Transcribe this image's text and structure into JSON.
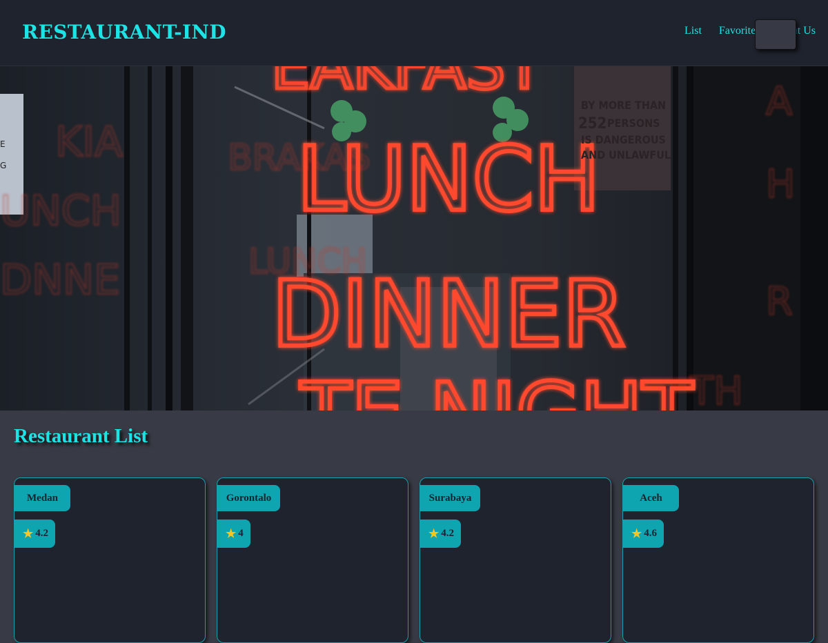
{
  "header": {
    "brand": "RESTAURANT-IND",
    "nav": [
      {
        "label": "List"
      },
      {
        "label": "Favorite"
      },
      {
        "label": "About Us"
      }
    ]
  },
  "hero": {
    "sign_lines": [
      "LUNCH",
      "DINNER"
    ],
    "notice_lines": [
      "BY MORE THAN",
      "252",
      "PERSONS",
      "IS DANGEROUS",
      "AND UNLAWFUL"
    ]
  },
  "main": {
    "title": "Restaurant List",
    "restaurants": [
      {
        "city": "Medan",
        "rating": "4.2"
      },
      {
        "city": "Gorontalo",
        "rating": "4"
      },
      {
        "city": "Surabaya",
        "rating": "4.2"
      },
      {
        "city": "Aceh",
        "rating": "4.6"
      }
    ]
  },
  "colors": {
    "accent": "#1ee3e6",
    "header_bg": "#1f232d",
    "page_bg": "#383b45",
    "badge_bg": "#0ea4b0",
    "neon": "#ff4a2e",
    "star": "#f9c623"
  },
  "icons": {
    "rating": "star-icon",
    "menu": "hamburger-menu-button"
  }
}
